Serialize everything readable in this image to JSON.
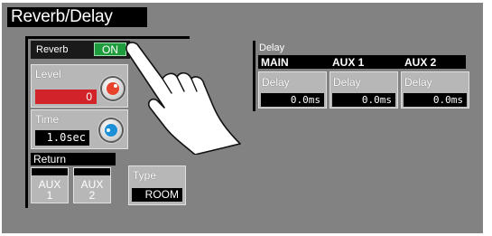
{
  "title": "Reverb/Delay",
  "reverb": {
    "label": "Reverb",
    "toggle": "ON",
    "level": {
      "label": "Level",
      "value": "0"
    },
    "time": {
      "label": "Time",
      "value": "1.0sec"
    },
    "return": {
      "label": "Return",
      "buttons": [
        {
          "line1": "AUX",
          "line2": "1"
        },
        {
          "line1": "AUX",
          "line2": "2"
        }
      ]
    },
    "type": {
      "label": "Type",
      "value": "ROOM"
    }
  },
  "delay": {
    "title": "Delay",
    "columns": [
      "MAIN",
      "AUX 1",
      "AUX 2"
    ],
    "items": [
      {
        "label": "Delay",
        "value": "0.0ms"
      },
      {
        "label": "Delay",
        "value": "0.0ms"
      },
      {
        "label": "Delay",
        "value": "0.0ms"
      }
    ]
  },
  "colors": {
    "on": "#1f9c3e",
    "level_value_bg": "#d2232a",
    "level_knob": "#e8412c",
    "time_knob": "#1c8fd6",
    "panel": "#828282"
  }
}
